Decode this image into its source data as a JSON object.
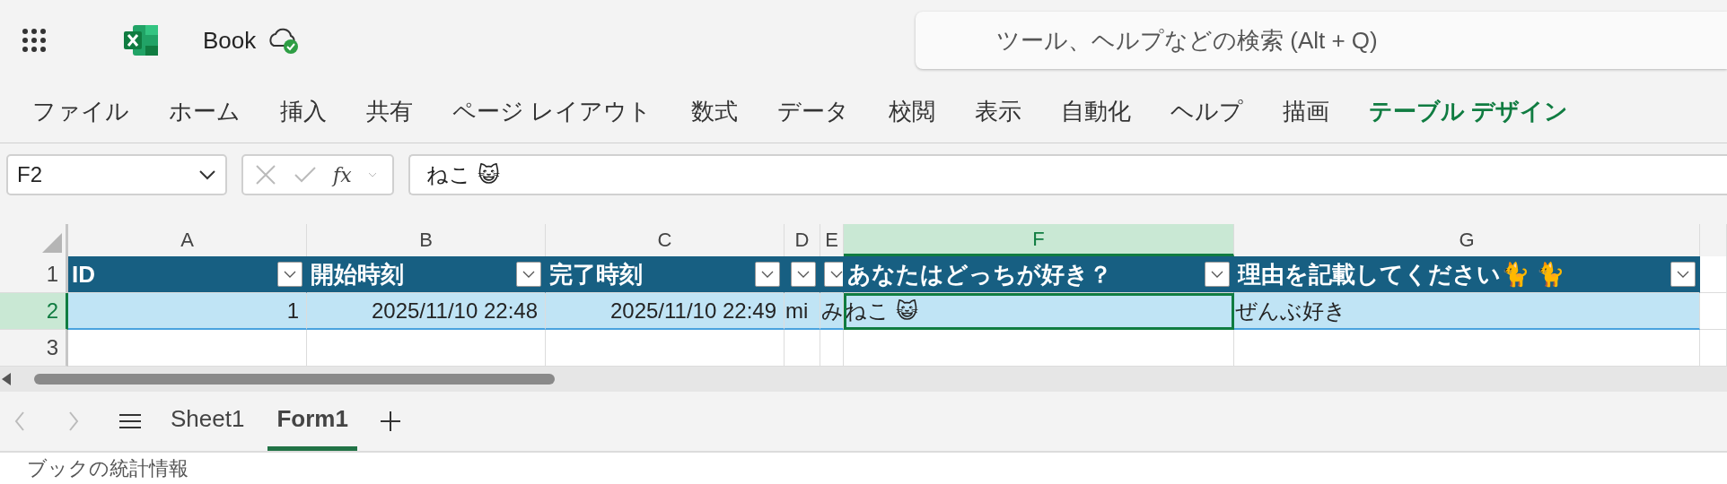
{
  "app": {
    "title": "Book"
  },
  "search": {
    "placeholder": "ツール、ヘルプなどの検索 (Alt + Q)"
  },
  "ribbon_tabs": [
    {
      "label": "ファイル",
      "contextual": false
    },
    {
      "label": "ホーム",
      "contextual": false
    },
    {
      "label": "挿入",
      "contextual": false
    },
    {
      "label": "共有",
      "contextual": false
    },
    {
      "label": "ページ レイアウト",
      "contextual": false
    },
    {
      "label": "数式",
      "contextual": false
    },
    {
      "label": "データ",
      "contextual": false
    },
    {
      "label": "校閲",
      "contextual": false
    },
    {
      "label": "表示",
      "contextual": false
    },
    {
      "label": "自動化",
      "contextual": false
    },
    {
      "label": "ヘルプ",
      "contextual": false
    },
    {
      "label": "描画",
      "contextual": false
    },
    {
      "label": "テーブル デザイン",
      "contextual": true
    }
  ],
  "name_box": {
    "value": "F2"
  },
  "formula_bar": {
    "function_label": "fx",
    "value": "ねこ 😺"
  },
  "columns": [
    {
      "label": "A",
      "selected": false
    },
    {
      "label": "B",
      "selected": false
    },
    {
      "label": "C",
      "selected": false
    },
    {
      "label": "D",
      "selected": false
    },
    {
      "label": "E",
      "selected": false
    },
    {
      "label": "F",
      "selected": true
    },
    {
      "label": "G",
      "selected": false
    }
  ],
  "rows": [
    {
      "number": "1",
      "selected": false,
      "kind": "table_header",
      "cells": [
        {
          "text": "ID",
          "filter": true
        },
        {
          "text": "開始時刻",
          "filter": true
        },
        {
          "text": "完了時刻",
          "filter": true
        },
        {
          "filter": true
        },
        {
          "filter": true
        },
        {
          "text": "あなたはどっちが好き？",
          "filter": true
        },
        {
          "text": "理由を記載してください🐈 🐈",
          "filter": true
        }
      ]
    },
    {
      "number": "2",
      "selected": true,
      "kind": "table_row",
      "cells": [
        {
          "text": "1",
          "kind": "number"
        },
        {
          "text": "2025/11/10 22:48",
          "kind": "number"
        },
        {
          "text": "2025/11/10 22:49",
          "kind": "number"
        },
        {
          "text": "mi",
          "kind": "text"
        },
        {
          "text": "み",
          "kind": "text"
        },
        {
          "text": "ねこ 😺",
          "kind": "text",
          "active": true
        },
        {
          "text": "ぜんぶ好き",
          "kind": "text"
        }
      ]
    },
    {
      "number": "3",
      "selected": false,
      "kind": "empty",
      "cells": []
    }
  ],
  "sheet_tabs": [
    {
      "label": "Sheet1",
      "selected": false
    },
    {
      "label": "Form1",
      "selected": true
    }
  ],
  "status_bar": {
    "text": "ブックの統計情報"
  }
}
